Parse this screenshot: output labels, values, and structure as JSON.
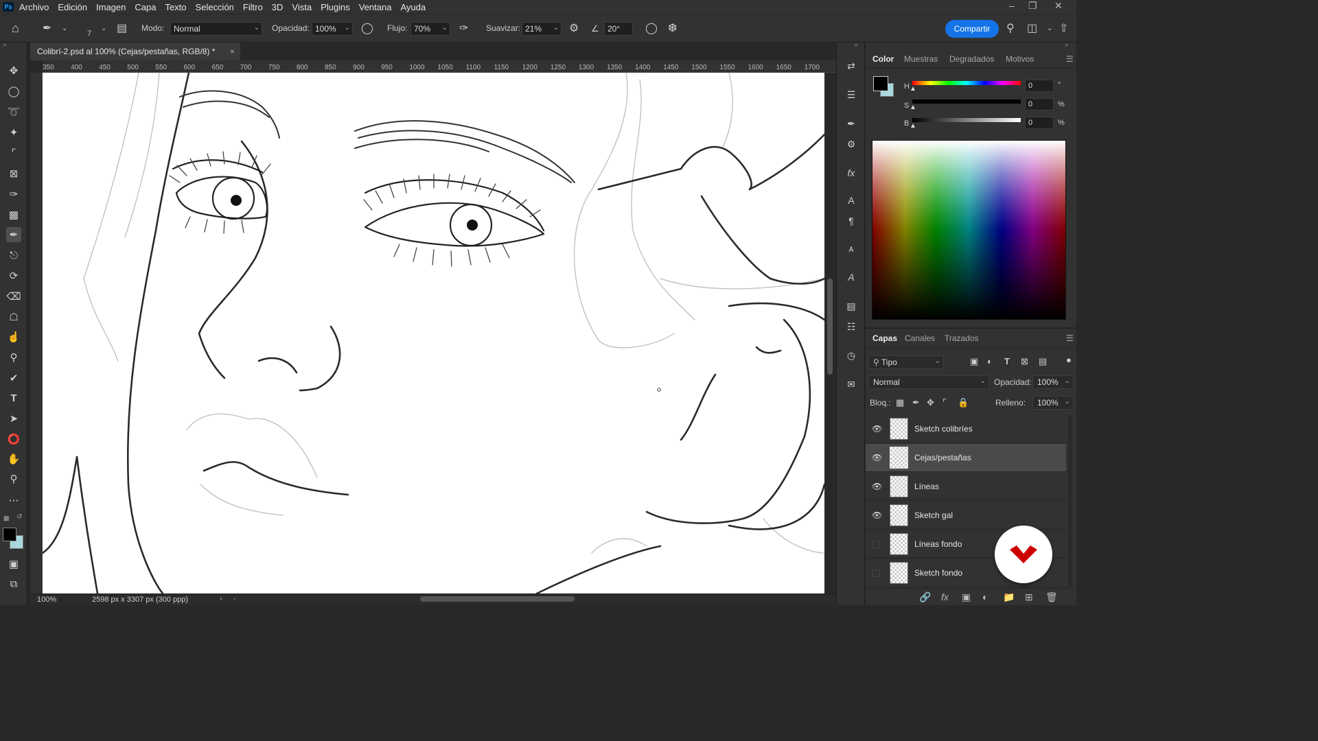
{
  "menubar": {
    "app_logo": "Ps",
    "items": [
      "Archivo",
      "Edición",
      "Imagen",
      "Capa",
      "Texto",
      "Selección",
      "Filtro",
      "3D",
      "Vista",
      "Plugins",
      "Ventana",
      "Ayuda"
    ]
  },
  "options": {
    "brush_size": "7",
    "mode_label": "Modo:",
    "mode_value": "Normal",
    "opacity_label": "Opacidad:",
    "opacity_value": "100%",
    "flow_label": "Flujo:",
    "flow_value": "70%",
    "smoothing_label": "Suavizar:",
    "smoothing_value": "21%",
    "angle_value": "20°",
    "share_label": "Compartir"
  },
  "document": {
    "tab_title": "Colibrí-2.psd al 100% (Cejas/pestañas, RGB/8) *",
    "zoom": "100%",
    "dimensions": "2598 px x 3307 px (300 ppp)"
  },
  "ruler": {
    "ticks": [
      "350",
      "400",
      "450",
      "500",
      "550",
      "600",
      "650",
      "700",
      "750",
      "800",
      "850",
      "900",
      "950",
      "1000",
      "1050",
      "1100",
      "1150",
      "1200",
      "1250",
      "1300",
      "1350",
      "1400",
      "1450",
      "1500",
      "1550",
      "1600",
      "1650",
      "1700"
    ]
  },
  "color_panel": {
    "tabs": [
      "Color",
      "Muestras",
      "Degradados",
      "Motivos"
    ],
    "h_label": "H",
    "h_value": "0",
    "h_unit": "°",
    "s_label": "S",
    "s_value": "0",
    "s_unit": "%",
    "b_label": "B",
    "b_value": "0",
    "b_unit": "%",
    "foreground": "#000000",
    "background": "#a8d8dc"
  },
  "layers_panel": {
    "tabs": [
      "Capas",
      "Canales",
      "Trazados"
    ],
    "filter_value": "Tipo",
    "blend_mode": "Normal",
    "opacity_label": "Opacidad:",
    "opacity_value": "100%",
    "lock_label": "Bloq.:",
    "fill_label": "Relleno:",
    "fill_value": "100%",
    "layers": [
      {
        "name": "Sketch colibríes",
        "visible": true
      },
      {
        "name": "Cejas/pestañas",
        "visible": true,
        "selected": true
      },
      {
        "name": "Líneas",
        "visible": true
      },
      {
        "name": "Sketch gal",
        "visible": true
      },
      {
        "name": "Líneas fondo",
        "visible": false
      },
      {
        "name": "Sketch fondo",
        "visible": false
      }
    ]
  },
  "colors": {
    "accent": "#1473e6",
    "brand_badge": "#cc0000"
  }
}
